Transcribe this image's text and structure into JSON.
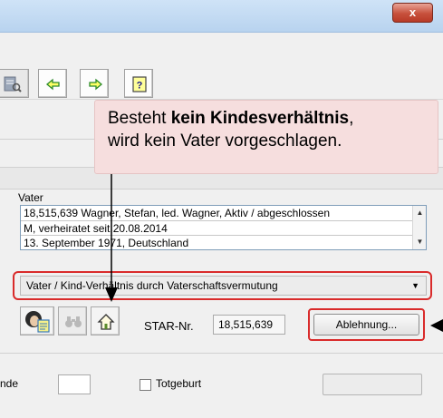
{
  "window": {
    "close_glyph": "x"
  },
  "toolbar": {
    "buttons": [
      {
        "icon": "document-search-icon"
      },
      {
        "icon": "arrow-left-icon"
      },
      {
        "icon": "arrow-right-icon"
      },
      {
        "icon": "help-icon"
      }
    ]
  },
  "callout": {
    "text_before": "Besteht ",
    "text_bold": "kein Kindesverhältnis",
    "text_after": ",",
    "line2": "wird kein Vater vorgeschlagen."
  },
  "vater": {
    "label": "Vater",
    "rows": [
      "18,515,639  Wagner, Stefan, led. Wagner, Aktiv / abgeschlossen",
      "M, verheiratet seit 20.08.2014",
      "13. September 1971, Deutschland"
    ]
  },
  "relationship_select": {
    "selected": "Vater / Kind-Verhältnis durch Vaterschaftsvermutung"
  },
  "person_controls": {
    "icons": [
      "person-card-icon",
      "binoculars-icon",
      "home-icon"
    ],
    "star_label": "STAR-Nr.",
    "star_value": "18,515,639",
    "reject_button": "Ablehnung..."
  },
  "bottom": {
    "partial_label": "nde",
    "checkbox_label": "Totgeburt"
  },
  "colors": {
    "highlight_red": "#d92b2b",
    "callout_bg": "#f6dede",
    "arrow_color": "#000000"
  }
}
